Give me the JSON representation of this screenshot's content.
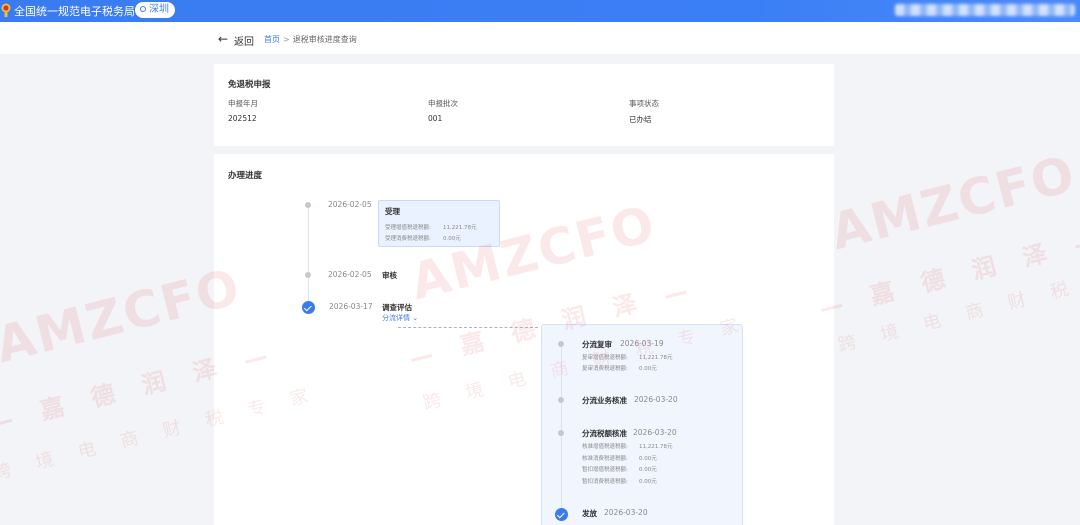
{
  "header": {
    "app_title": "全国统一规范电子税务局",
    "city": "深圳"
  },
  "subnav": {
    "back_label": "返回",
    "breadcrumb_home": "首页",
    "breadcrumb_sep": ">",
    "breadcrumb_current": "退税审核进度查询"
  },
  "declaration": {
    "title": "免退税申报",
    "fields": [
      {
        "label": "申报年月",
        "value": "202512"
      },
      {
        "label": "申报批次",
        "value": "001"
      },
      {
        "label": "事项状态",
        "value": "已办结"
      }
    ]
  },
  "progress": {
    "title": "办理进度",
    "steps": [
      {
        "date": "2026-02-05",
        "title": "受理",
        "details": [
          {
            "label": "受理增值税退税额:",
            "value": "11,221.78元"
          },
          {
            "label": "受理消费税退税额:",
            "value": "0.00元"
          }
        ]
      },
      {
        "date": "2026-02-05",
        "title": "审核"
      },
      {
        "date": "2026-03-17",
        "title": "调查评估",
        "link": "分流详情"
      }
    ],
    "sub_steps": [
      {
        "title": "分流复审",
        "date": "2026-03-19",
        "details": [
          {
            "label": "复审增值税退税额:",
            "value": "11,221.78元"
          },
          {
            "label": "复审消费税退税额:",
            "value": "0.00元"
          }
        ]
      },
      {
        "title": "分流业务核准",
        "date": "2026-03-20"
      },
      {
        "title": "分流税额核准",
        "date": "2026-03-20",
        "details": [
          {
            "label": "核准增值税退税额:",
            "value": "11,221.78元"
          },
          {
            "label": "核准消费税退税额:",
            "value": "0.00元"
          },
          {
            "label": "暂扣增值税退税额:",
            "value": "0.00元"
          },
          {
            "label": "暂扣消费税退税额:",
            "value": "0.00元"
          }
        ]
      },
      {
        "title": "发放",
        "date": "2026-03-20"
      }
    ]
  },
  "watermark": {
    "brand": "AMZCFO",
    "line1": "— 嘉 德 润 泽 —",
    "line2": "跨 境 电 商 财 税 专 家"
  },
  "colors": {
    "primary": "#3a7bf0",
    "background": "#f2f4f7",
    "watermark": "#e67878"
  }
}
